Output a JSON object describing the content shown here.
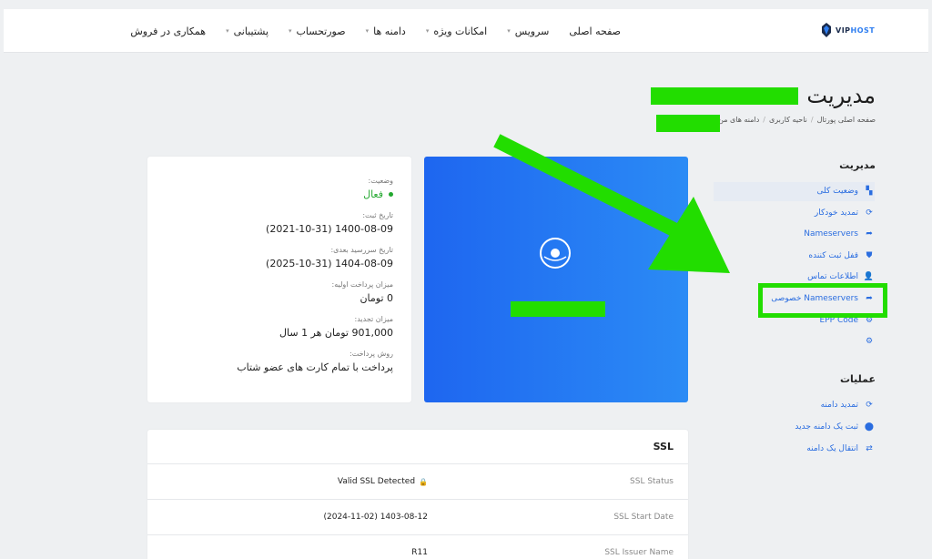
{
  "logo": {
    "prefix": "VIP",
    "suffix": "HOST"
  },
  "nav": {
    "items": [
      {
        "label": "صفحه اصلی",
        "caret": false
      },
      {
        "label": "سرویس",
        "caret": true
      },
      {
        "label": "امکانات ویژه",
        "caret": true
      },
      {
        "label": "دامنه ها",
        "caret": true
      },
      {
        "label": "صورتحساب",
        "caret": true
      },
      {
        "label": "پشتیبانی",
        "caret": true
      },
      {
        "label": "همکاری در فروش",
        "caret": false
      }
    ]
  },
  "page": {
    "title": "مدیریت",
    "breadcrumb": [
      "صفحه اصلی پورتال",
      "ناحیه کاربری",
      "دامنه های من"
    ]
  },
  "sidebar": {
    "manage_heading": "مدیریت",
    "manage_items": [
      {
        "label": "وضعیت کلی",
        "icon": "dashboard-icon",
        "glyph": "▚"
      },
      {
        "label": "تمدید خودکار",
        "icon": "refresh-icon",
        "glyph": "⟳"
      },
      {
        "label": "Nameservers",
        "icon": "share-icon",
        "glyph": "➦"
      },
      {
        "label": "قفل ثبت کننده",
        "icon": "shield-icon",
        "glyph": "⛊"
      },
      {
        "label": "اطلاعات تماس",
        "icon": "user-icon",
        "glyph": "👤"
      },
      {
        "label": "Nameservers خصوصی",
        "icon": "share-icon",
        "glyph": "➦"
      },
      {
        "label": "EPP Code",
        "icon": "gear-icon",
        "glyph": "⚙"
      },
      {
        "label": "",
        "icon": "gear-icon",
        "glyph": "⚙"
      }
    ],
    "actions_heading": "عملیات",
    "action_items": [
      {
        "label": "تمدید دامنه",
        "icon": "refresh-icon",
        "glyph": "⟳"
      },
      {
        "label": "ثبت یک دامنه جدید",
        "icon": "tag-icon",
        "glyph": "⬤"
      },
      {
        "label": "انتقال یک دامنه",
        "icon": "transfer-icon",
        "glyph": "⇄"
      }
    ]
  },
  "info": {
    "status_label": "وضعیت:",
    "status_value": "فعال",
    "reg_date_label": "تاریخ ثبت:",
    "reg_date_value": "1400-08-09 (2021-10-31)",
    "due_date_label": "تاریخ سررسید بعدی:",
    "due_date_value": "1404-08-09 (2025-10-31)",
    "first_pay_label": "میزان پرداخت اولیه:",
    "first_pay_value": "0 تومان",
    "renew_label": "میزان تجدید:",
    "renew_value": "901,000 تومان هر 1 سال",
    "pay_method_label": "روش پرداخت:",
    "pay_method_value": "پرداخت با تمام کارت های عضو شتاب"
  },
  "ssl": {
    "title": "SSL",
    "rows": [
      {
        "key": "SSL Status",
        "value": "Valid SSL Detected",
        "lock": true
      },
      {
        "key": "SSL Start Date",
        "value": "1403-08-12 (2024-11-02)",
        "lock": false
      },
      {
        "key": "SSL Issuer Name",
        "value": "R11",
        "lock": false
      }
    ]
  },
  "colors": {
    "accent": "#2a6de0",
    "panel_gradient_start": "#1e66f0",
    "panel_gradient_end": "#2b8bf5",
    "active_status": "#23a82f",
    "annotation_green": "#22dd00"
  }
}
